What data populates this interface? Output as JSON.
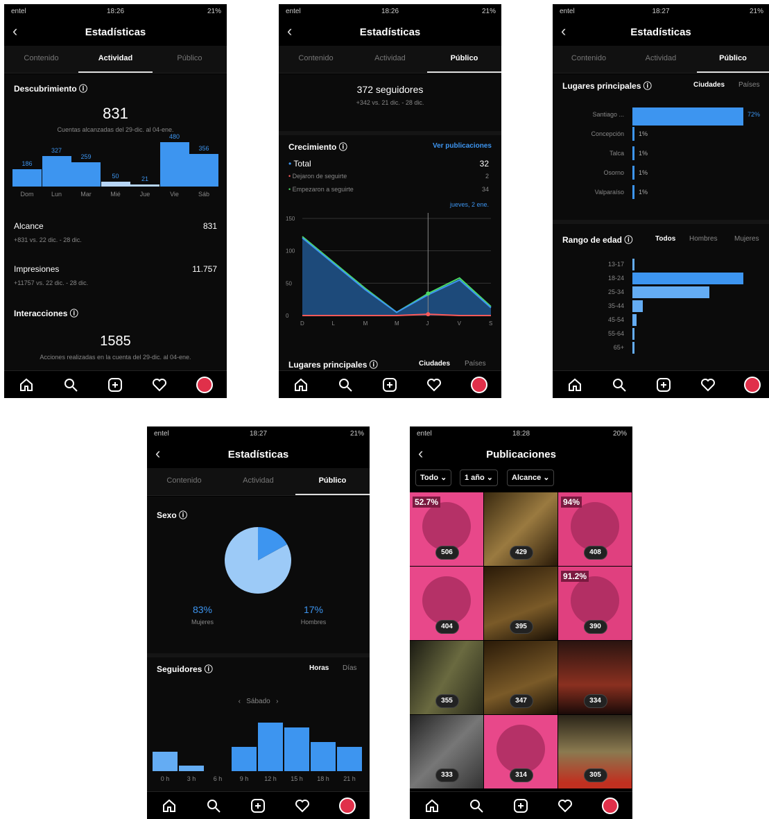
{
  "status": {
    "carrier": "entel",
    "time1": "18:26",
    "time2": "18:26",
    "time3": "18:27",
    "time4": "18:27",
    "time5": "18:28",
    "battery1": "21%",
    "battery5": "20%"
  },
  "header": {
    "title": "Estadísticas",
    "pub_title": "Publicaciones"
  },
  "tabs": {
    "contenido": "Contenido",
    "actividad": "Actividad",
    "publico": "Público"
  },
  "s1": {
    "discovery_title": "Descubrimiento",
    "reach_value": "831",
    "reach_caption": "Cuentas alcanzadas del 29-dic. al 04-ene.",
    "days": [
      "Dom",
      "Lun",
      "Mar",
      "Mié",
      "Jue",
      "Vie",
      "Sáb"
    ],
    "day_values": [
      186,
      327,
      259,
      50,
      21,
      480,
      356
    ],
    "alcance_label": "Alcance",
    "alcance_value": "831",
    "alcance_sub": "+831 vs. 22 dic. - 28 dic.",
    "impresiones_label": "Impresiones",
    "impresiones_value": "11.757",
    "impresiones_sub": "+11757 vs. 22 dic. - 28 dic.",
    "interacciones_title": "Interacciones",
    "interacciones_value": "1585",
    "interacciones_caption": "Acciones realizadas en la cuenta del 29-dic. al 04-ene."
  },
  "s2": {
    "followers": "372 seguidores",
    "followers_sub": "+342 vs. 21 dic. - 28 dic.",
    "growth_title": "Crecimiento",
    "see_posts": "Ver publicaciones",
    "total_label": "Total",
    "total_value": "32",
    "unfollow_label": "Dejaron de seguirte",
    "unfollow_value": "2",
    "follow_label": "Empezaron a seguirte",
    "follow_value": "34",
    "tooltip": "jueves, 2 ene.",
    "y_ticks": [
      "150",
      "100",
      "50",
      "0"
    ],
    "x_ticks": [
      "D",
      "L",
      "M",
      "M",
      "J",
      "V",
      "S"
    ],
    "places_title": "Lugares principales",
    "ciudades": "Ciudades",
    "paises": "Países"
  },
  "chart_data": {
    "type": "area",
    "categories": [
      "D",
      "L",
      "M",
      "M",
      "J",
      "V",
      "S"
    ],
    "ylim": [
      0,
      150
    ],
    "series": [
      {
        "name": "Total",
        "values": [
          120,
          80,
          40,
          5,
          32,
          55,
          12
        ]
      },
      {
        "name": "Dejaron de seguirte",
        "values": [
          0,
          0,
          0,
          0,
          2,
          0,
          0
        ]
      },
      {
        "name": "Empezaron a seguirte",
        "values": [
          122,
          82,
          42,
          5,
          34,
          58,
          14
        ]
      }
    ]
  },
  "s3": {
    "places_title": "Lugares principales",
    "ciudades": "Ciudades",
    "paises": "Países",
    "cities": [
      "Santiago ...",
      "Concepción",
      "Talca",
      "Osorno",
      "Valparaíso"
    ],
    "city_values": [
      72,
      1,
      1,
      1,
      1
    ],
    "city_labels": [
      "72%",
      "1%",
      "1%",
      "1%",
      "1%"
    ],
    "age_title": "Rango de edad",
    "todos": "Todos",
    "hombres": "Hombres",
    "mujeres": "Mujeres",
    "ages": [
      "13-17",
      "18-24",
      "25-34",
      "35-44",
      "45-54",
      "55-64",
      "65+"
    ],
    "age_values": [
      1,
      52,
      36,
      5,
      2,
      1,
      1
    ]
  },
  "s4": {
    "sex_title": "Sexo",
    "women_pct": "83%",
    "women_label": "Mujeres",
    "men_pct": "17%",
    "men_label": "Hombres",
    "women_value": 83,
    "men_value": 17,
    "followers_title": "Seguidores",
    "horas": "Horas",
    "dias": "Días",
    "day_nav": "Sábado",
    "hours": [
      "0 h",
      "3 h",
      "6 h",
      "9 h",
      "12 h",
      "15 h",
      "18 h",
      "21 h"
    ],
    "hour_values": [
      22,
      6,
      0,
      28,
      55,
      50,
      33,
      28
    ]
  },
  "s5": {
    "filter_all": "Todo",
    "filter_year": "1 año",
    "filter_metric": "Alcance",
    "posts": [
      "506",
      "429",
      "408",
      "404",
      "395",
      "390",
      "355",
      "347",
      "334",
      "333",
      "314",
      "305"
    ],
    "badge_a": "52.7%",
    "badge_b": "94%",
    "badge_c": "91.2%"
  },
  "colors": {
    "accent": "#3d95f0",
    "light": "#64acf3",
    "pink": "#e8488a",
    "green": "#4cd964",
    "red": "#ff5a5a"
  }
}
